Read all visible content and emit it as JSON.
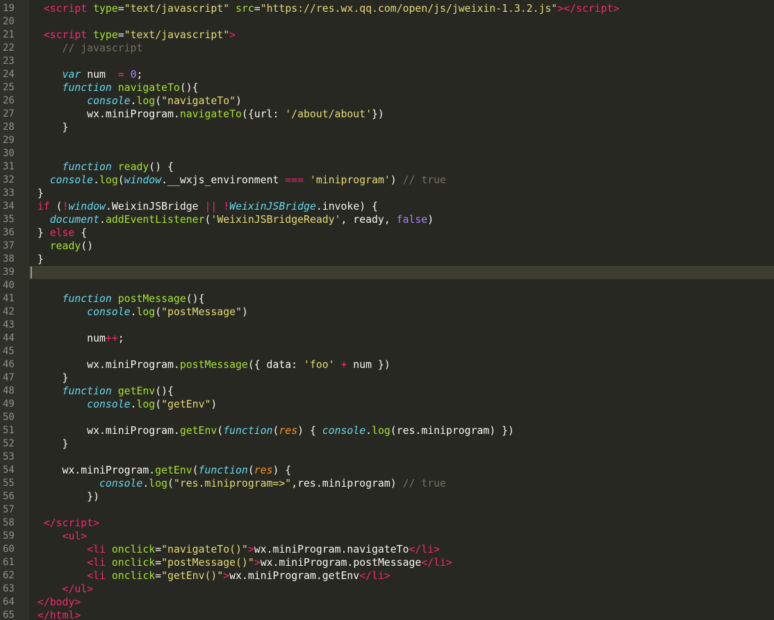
{
  "editor": {
    "theme": "monokai",
    "colors": {
      "background": "#272822",
      "gutter": "#2f3129",
      "tag": "#f92672",
      "attr": "#a6e22e",
      "string": "#e6db74",
      "keyword": "#66d9ef",
      "number": "#ae81ff",
      "comment": "#75715e",
      "param": "#fd971f",
      "plain": "#f8f8f2"
    },
    "current_line": 39,
    "lines": [
      {
        "n": "19",
        "tokens": [
          [
            "p",
            "  "
          ],
          [
            "tag",
            "<script"
          ],
          [
            "p",
            " "
          ],
          [
            "attr",
            "type"
          ],
          [
            "p",
            "="
          ],
          [
            "str",
            "\"text/javascript\""
          ],
          [
            "p",
            " "
          ],
          [
            "attr",
            "src"
          ],
          [
            "p",
            "="
          ],
          [
            "str",
            "\"https://res.wx.qq.com/open/js/jweixin-1.3.2.js\""
          ],
          [
            "tag",
            ">"
          ],
          [
            "tag",
            "</script"
          ],
          [
            "tag",
            ">"
          ]
        ]
      },
      {
        "n": "20",
        "tokens": []
      },
      {
        "n": "21",
        "tokens": [
          [
            "p",
            "  "
          ],
          [
            "tag",
            "<script"
          ],
          [
            "p",
            " "
          ],
          [
            "attr",
            "type"
          ],
          [
            "p",
            "="
          ],
          [
            "str",
            "\"text/javascript\""
          ],
          [
            "tag",
            ">"
          ]
        ]
      },
      {
        "n": "22",
        "tokens": [
          [
            "p",
            "     "
          ],
          [
            "comment",
            "// javascript"
          ]
        ]
      },
      {
        "n": "23",
        "tokens": []
      },
      {
        "n": "24",
        "tokens": [
          [
            "p",
            "     "
          ],
          [
            "kw",
            "var"
          ],
          [
            "p",
            " num  "
          ],
          [
            "op",
            "="
          ],
          [
            "p",
            " "
          ],
          [
            "num",
            "0"
          ],
          [
            "p",
            ";"
          ]
        ]
      },
      {
        "n": "25",
        "tokens": [
          [
            "p",
            "     "
          ],
          [
            "kw",
            "function"
          ],
          [
            "p",
            " "
          ],
          [
            "fn",
            "navigateTo"
          ],
          [
            "p",
            "(){"
          ]
        ]
      },
      {
        "n": "26",
        "tokens": [
          [
            "p",
            "         "
          ],
          [
            "builtin",
            "console"
          ],
          [
            "p",
            "."
          ],
          [
            "fn",
            "log"
          ],
          [
            "p",
            "("
          ],
          [
            "str",
            "\"navigateTo\""
          ],
          [
            "p",
            ")"
          ]
        ]
      },
      {
        "n": "27",
        "tokens": [
          [
            "p",
            "         wx.miniProgram."
          ],
          [
            "fn",
            "navigateTo"
          ],
          [
            "p",
            "({url: "
          ],
          [
            "str",
            "'/about/about'"
          ],
          [
            "p",
            "})"
          ]
        ]
      },
      {
        "n": "28",
        "tokens": [
          [
            "p",
            "     }"
          ]
        ]
      },
      {
        "n": "29",
        "tokens": []
      },
      {
        "n": "30",
        "tokens": []
      },
      {
        "n": "31",
        "tokens": [
          [
            "p",
            "     "
          ],
          [
            "kw",
            "function"
          ],
          [
            "p",
            " "
          ],
          [
            "fn",
            "ready"
          ],
          [
            "p",
            "() {"
          ]
        ]
      },
      {
        "n": "32",
        "tokens": [
          [
            "p",
            "   "
          ],
          [
            "builtin",
            "console"
          ],
          [
            "p",
            "."
          ],
          [
            "fn",
            "log"
          ],
          [
            "p",
            "("
          ],
          [
            "builtin",
            "window"
          ],
          [
            "p",
            ".__wxjs_environment "
          ],
          [
            "op",
            "==="
          ],
          [
            "p",
            " "
          ],
          [
            "str",
            "'miniprogram'"
          ],
          [
            "p",
            ") "
          ],
          [
            "comment",
            "// true"
          ]
        ]
      },
      {
        "n": "33",
        "tokens": [
          [
            "p",
            " }"
          ]
        ]
      },
      {
        "n": "34",
        "tokens": [
          [
            "op",
            " if"
          ],
          [
            "p",
            " ("
          ],
          [
            "op",
            "!"
          ],
          [
            "builtin",
            "window"
          ],
          [
            "p",
            ".WeixinJSBridge "
          ],
          [
            "op",
            "||"
          ],
          [
            "p",
            " "
          ],
          [
            "op",
            "!"
          ],
          [
            "builtin",
            "WeixinJSBridge"
          ],
          [
            "p",
            ".invoke) {"
          ]
        ]
      },
      {
        "n": "35",
        "tokens": [
          [
            "p",
            "   "
          ],
          [
            "builtin",
            "document"
          ],
          [
            "p",
            "."
          ],
          [
            "fn",
            "addEventListener"
          ],
          [
            "p",
            "("
          ],
          [
            "str",
            "'WeixinJSBridgeReady'"
          ],
          [
            "p",
            ", ready, "
          ],
          [
            "const",
            "false"
          ],
          [
            "p",
            ")"
          ]
        ]
      },
      {
        "n": "36",
        "tokens": [
          [
            "p",
            " } "
          ],
          [
            "op",
            "else"
          ],
          [
            "p",
            " {"
          ]
        ]
      },
      {
        "n": "37",
        "tokens": [
          [
            "p",
            "   "
          ],
          [
            "fn",
            "ready"
          ],
          [
            "p",
            "()"
          ]
        ]
      },
      {
        "n": "38",
        "tokens": [
          [
            "p",
            " }"
          ]
        ]
      },
      {
        "n": "39",
        "tokens": []
      },
      {
        "n": "40",
        "tokens": []
      },
      {
        "n": "41",
        "tokens": [
          [
            "p",
            "     "
          ],
          [
            "kw",
            "function"
          ],
          [
            "p",
            " "
          ],
          [
            "fn",
            "postMessage"
          ],
          [
            "p",
            "(){"
          ]
        ]
      },
      {
        "n": "42",
        "tokens": [
          [
            "p",
            "         "
          ],
          [
            "builtin",
            "console"
          ],
          [
            "p",
            "."
          ],
          [
            "fn",
            "log"
          ],
          [
            "p",
            "("
          ],
          [
            "str",
            "\"postMessage\""
          ],
          [
            "p",
            ")"
          ]
        ]
      },
      {
        "n": "43",
        "tokens": []
      },
      {
        "n": "44",
        "tokens": [
          [
            "p",
            "         num"
          ],
          [
            "op",
            "++"
          ],
          [
            "p",
            ";"
          ]
        ]
      },
      {
        "n": "45",
        "tokens": []
      },
      {
        "n": "46",
        "tokens": [
          [
            "p",
            "         wx.miniProgram."
          ],
          [
            "fn",
            "postMessage"
          ],
          [
            "p",
            "({ data: "
          ],
          [
            "str",
            "'foo'"
          ],
          [
            "p",
            " "
          ],
          [
            "op",
            "+"
          ],
          [
            "p",
            " num })"
          ]
        ]
      },
      {
        "n": "47",
        "tokens": [
          [
            "p",
            "     }"
          ]
        ]
      },
      {
        "n": "48",
        "tokens": [
          [
            "p",
            "     "
          ],
          [
            "kw",
            "function"
          ],
          [
            "p",
            " "
          ],
          [
            "fn",
            "getEnv"
          ],
          [
            "p",
            "(){"
          ]
        ]
      },
      {
        "n": "49",
        "tokens": [
          [
            "p",
            "         "
          ],
          [
            "builtin",
            "console"
          ],
          [
            "p",
            "."
          ],
          [
            "fn",
            "log"
          ],
          [
            "p",
            "("
          ],
          [
            "str",
            "\"getEnv\""
          ],
          [
            "p",
            ")"
          ]
        ]
      },
      {
        "n": "50",
        "tokens": []
      },
      {
        "n": "51",
        "tokens": [
          [
            "p",
            "         wx.miniProgram."
          ],
          [
            "fn",
            "getEnv"
          ],
          [
            "p",
            "("
          ],
          [
            "kw",
            "function"
          ],
          [
            "p",
            "("
          ],
          [
            "param",
            "res"
          ],
          [
            "p",
            ") { "
          ],
          [
            "builtin",
            "console"
          ],
          [
            "p",
            "."
          ],
          [
            "fn",
            "log"
          ],
          [
            "p",
            "(res.miniprogram) })"
          ]
        ]
      },
      {
        "n": "52",
        "tokens": [
          [
            "p",
            "     }"
          ]
        ]
      },
      {
        "n": "53",
        "tokens": []
      },
      {
        "n": "54",
        "tokens": [
          [
            "p",
            "     wx.miniProgram."
          ],
          [
            "fn",
            "getEnv"
          ],
          [
            "p",
            "("
          ],
          [
            "kw",
            "function"
          ],
          [
            "p",
            "("
          ],
          [
            "param",
            "res"
          ],
          [
            "p",
            ") {"
          ]
        ]
      },
      {
        "n": "55",
        "tokens": [
          [
            "p",
            "           "
          ],
          [
            "builtin",
            "console"
          ],
          [
            "p",
            "."
          ],
          [
            "fn",
            "log"
          ],
          [
            "p",
            "("
          ],
          [
            "str",
            "\"res.miniprogram=>\""
          ],
          [
            "p",
            ",res.miniprogram) "
          ],
          [
            "comment",
            "// true"
          ]
        ]
      },
      {
        "n": "56",
        "tokens": [
          [
            "p",
            "         })"
          ]
        ]
      },
      {
        "n": "57",
        "tokens": []
      },
      {
        "n": "58",
        "tokens": [
          [
            "p",
            "  "
          ],
          [
            "tag",
            "</script"
          ],
          [
            "tag",
            ">"
          ]
        ]
      },
      {
        "n": "59",
        "tokens": [
          [
            "p",
            "     "
          ],
          [
            "tag",
            "<ul"
          ],
          [
            "tag",
            ">"
          ]
        ]
      },
      {
        "n": "60",
        "tokens": [
          [
            "p",
            "         "
          ],
          [
            "tag",
            "<li"
          ],
          [
            "p",
            " "
          ],
          [
            "attr",
            "onclick"
          ],
          [
            "p",
            "="
          ],
          [
            "str",
            "\"navigateTo()\""
          ],
          [
            "tag",
            ">"
          ],
          [
            "p",
            "wx.miniProgram.navigateTo"
          ],
          [
            "tag",
            "</li"
          ],
          [
            "tag",
            ">"
          ]
        ]
      },
      {
        "n": "61",
        "tokens": [
          [
            "p",
            "         "
          ],
          [
            "tag",
            "<li"
          ],
          [
            "p",
            " "
          ],
          [
            "attr",
            "onclick"
          ],
          [
            "p",
            "="
          ],
          [
            "str",
            "\"postMessage()\""
          ],
          [
            "tag",
            ">"
          ],
          [
            "p",
            "wx.miniProgram.postMessage"
          ],
          [
            "tag",
            "</li"
          ],
          [
            "tag",
            ">"
          ]
        ]
      },
      {
        "n": "62",
        "tokens": [
          [
            "p",
            "         "
          ],
          [
            "tag",
            "<li"
          ],
          [
            "p",
            " "
          ],
          [
            "attr",
            "onclick"
          ],
          [
            "p",
            "="
          ],
          [
            "str",
            "\"getEnv()\""
          ],
          [
            "tag",
            ">"
          ],
          [
            "p",
            "wx.miniProgram.getEnv"
          ],
          [
            "tag",
            "</li"
          ],
          [
            "tag",
            ">"
          ]
        ]
      },
      {
        "n": "63",
        "tokens": [
          [
            "p",
            "     "
          ],
          [
            "tag",
            "</ul"
          ],
          [
            "tag",
            ">"
          ]
        ]
      },
      {
        "n": "64",
        "tokens": [
          [
            "p",
            " "
          ],
          [
            "tag",
            "</body"
          ],
          [
            "tag",
            ">"
          ]
        ]
      },
      {
        "n": "65",
        "tokens": [
          [
            "p",
            " "
          ],
          [
            "tag",
            "</html"
          ],
          [
            "tag",
            ">"
          ]
        ]
      }
    ]
  }
}
